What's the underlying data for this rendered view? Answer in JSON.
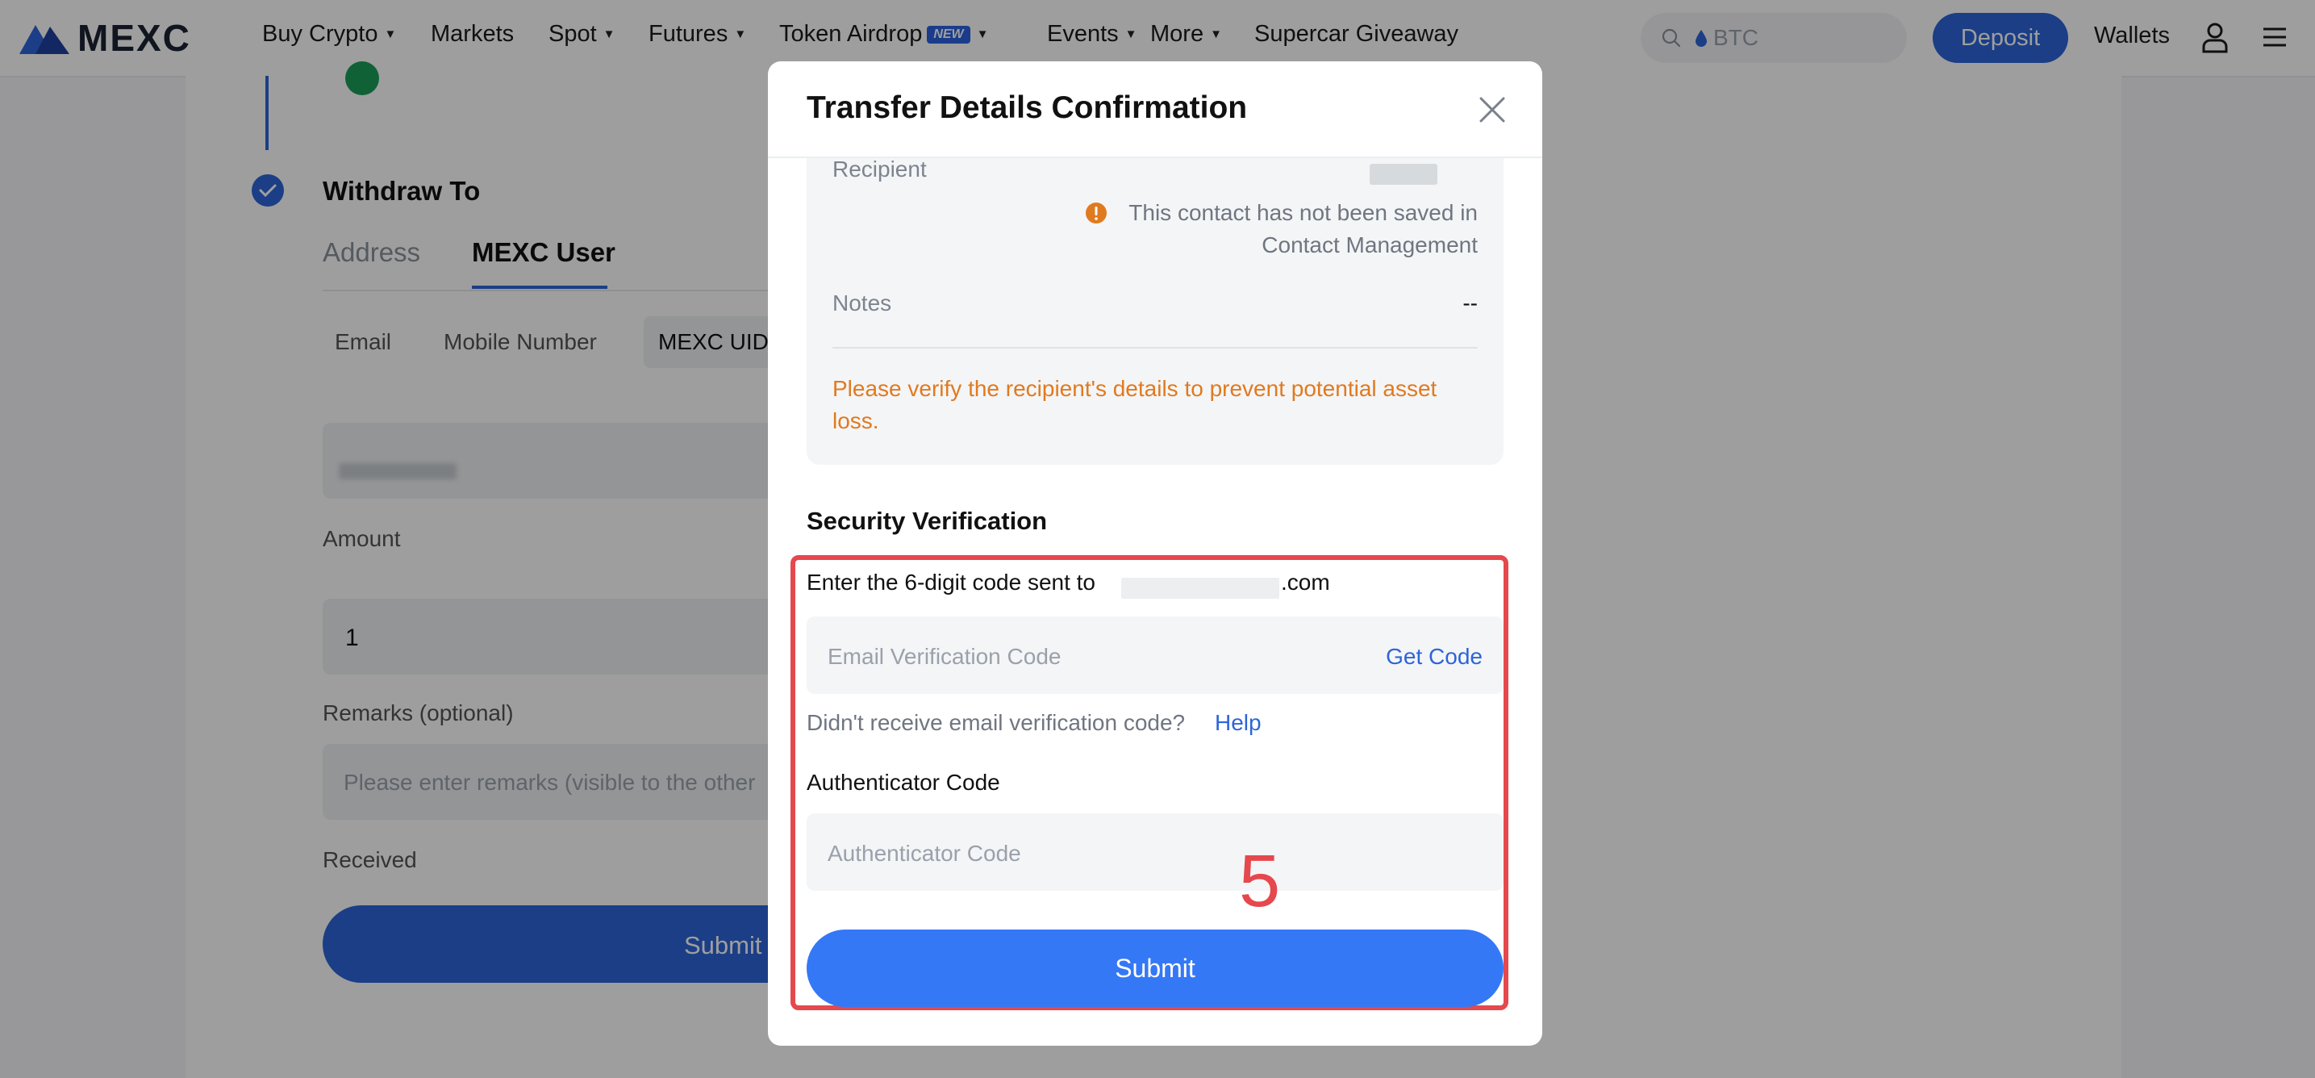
{
  "nav": {
    "logo_text": "MEXC",
    "items": [
      {
        "label": "Buy Crypto",
        "caret": true
      },
      {
        "label": "Markets",
        "caret": false
      },
      {
        "label": "Spot",
        "caret": true
      },
      {
        "label": "Futures",
        "caret": true
      },
      {
        "label": "Token Airdrop",
        "caret": true,
        "badge": "NEW"
      },
      {
        "label": "Events",
        "caret": true
      },
      {
        "label": "More",
        "caret": true
      },
      {
        "label": "Supercar Giveaway",
        "caret": false
      }
    ],
    "search_placeholder": "BTC",
    "deposit_label": "Deposit",
    "wallets_label": "Wallets",
    "brand_color": "#2d65d8"
  },
  "background_page": {
    "section_title": "Withdraw To",
    "tabs": [
      "Address",
      "MEXC User"
    ],
    "active_tab": "MEXC User",
    "subtabs": [
      "Email",
      "Mobile Number",
      "MEXC UID"
    ],
    "amount_label": "Amount",
    "amount_value": "1",
    "remarks_label": "Remarks (optional)",
    "remarks_placeholder": "Please enter remarks (visible to the other",
    "received_label": "Received",
    "submit_label": "Submit"
  },
  "modal": {
    "title": "Transfer Details Confirmation",
    "recipient_label": "Recipient",
    "contact_warning_line1": "This contact has not been saved in",
    "contact_warning_line2": "Contact Management",
    "notes_label": "Notes",
    "notes_value": "--",
    "verify_warning_line1": "Please verify the recipient's details to prevent potential asset",
    "verify_warning_line2": "loss.",
    "security_heading": "Security Verification",
    "email_code_prompt": "Enter the 6-digit code sent to",
    "email_suffix": ".com",
    "email_code_placeholder": "Email Verification Code",
    "get_code_label": "Get Code",
    "no_code_text": "Didn't receive email verification code?",
    "help_label": "Help",
    "auth_heading": "Authenticator Code",
    "auth_placeholder": "Authenticator Code",
    "submit_label": "Submit",
    "step_number": "5",
    "warning_color": "#e07a1f",
    "link_color": "#2d65d8",
    "highlight_color": "#e5484d"
  }
}
